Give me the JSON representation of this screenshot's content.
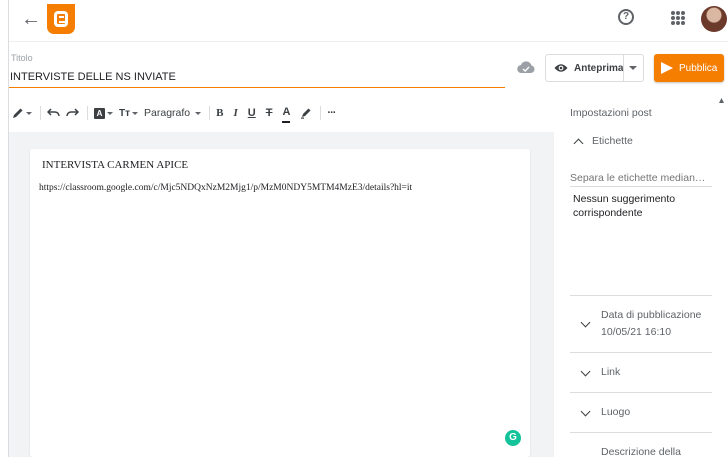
{
  "app": {
    "logo": "blogger-logo",
    "accent_color": "#f57d00"
  },
  "topbar": {
    "back_icon": "arrow-left-icon",
    "help_icon": "help-circle-icon",
    "apps_icon": "apps-grid-icon",
    "avatar": "user-avatar"
  },
  "post": {
    "title_label": "Titolo",
    "title_value": "INTERVISTE DELLE NS INVIATE"
  },
  "actions": {
    "preview_label": "Anteprima",
    "publish_label": "Pubblica"
  },
  "toolbar": {
    "paragraph_label": "Paragrafo",
    "bold": "B",
    "italic": "I",
    "underline": "U",
    "strike": "T",
    "text_color": "A",
    "font_label": "A",
    "size_label": "Tт",
    "more": "···"
  },
  "editor": {
    "heading": "INTERVISTA CARMEN APICE",
    "url": "https://classroom.google.com/c/Mjc5NDQxNzM2Mjg1/p/MzM0NDY5MTM4MzE3/details?hl=it",
    "grammarly_badge": "G"
  },
  "settings": {
    "title": "Impostazioni post",
    "labels_section": "Etichette",
    "labels_placeholder": "Separa le etichette median…",
    "no_suggestion": "Nessun suggerimento corrispondente",
    "publish_date_label": "Data di pubblicazione",
    "publish_date_value": "10/05/21 16:10",
    "link_section": "Link",
    "location_section": "Luogo",
    "description_section": "Descrizione della"
  }
}
